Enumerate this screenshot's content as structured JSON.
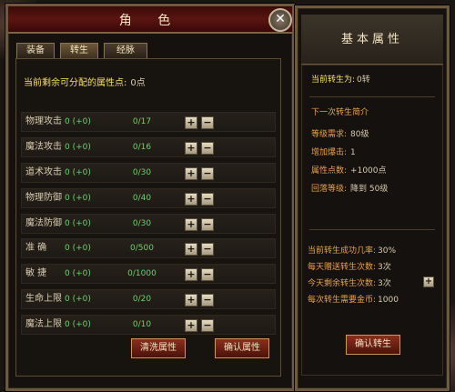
{
  "window": {
    "title": "角 色",
    "close_label": "✕"
  },
  "tabs": [
    {
      "label": "装备",
      "active": false
    },
    {
      "label": "转生",
      "active": true
    },
    {
      "label": "经脉",
      "active": false
    }
  ],
  "points": {
    "label": "当前剩余可分配的属性点:",
    "value": "0点"
  },
  "attributes": [
    {
      "name": "物理攻击",
      "bonus": "0 (+0)",
      "max": "0/17"
    },
    {
      "name": "魔法攻击",
      "bonus": "0 (+0)",
      "max": "0/16"
    },
    {
      "name": "道术攻击",
      "bonus": "0 (+0)",
      "max": "0/30"
    },
    {
      "name": "物理防御",
      "bonus": "0 (+0)",
      "max": "0/40"
    },
    {
      "name": "魔法防御",
      "bonus": "0 (+0)",
      "max": "0/30"
    },
    {
      "name": "准    确",
      "bonus": "0 (+0)",
      "max": "0/500"
    },
    {
      "name": "敏    捷",
      "bonus": "0 (+0)",
      "max": "0/1000"
    },
    {
      "name": "生命上限",
      "bonus": "0 (+0)",
      "max": "0/20"
    },
    {
      "name": "魔法上限",
      "bonus": "0 (+0)",
      "max": "0/10"
    }
  ],
  "buttons": {
    "reset": "清洗属性",
    "confirm_attr": "确认属性",
    "confirm_reborn": "确认转生"
  },
  "plus_glyph": "+",
  "minus_glyph": "−",
  "right": {
    "title": "基本属性",
    "current_reborn_label": "当前转生为:",
    "current_reborn_value": "0转",
    "next_title": "下一次转生简介",
    "next_items": [
      {
        "label": "等级需求:",
        "value": "80级"
      },
      {
        "label": "增加爆击:",
        "value": "1"
      },
      {
        "label": "属性点数:",
        "value": "+1000点"
      },
      {
        "label": "回落等级:",
        "value": "降到  50级"
      }
    ],
    "stats": [
      {
        "label": "当前转生成功几率:",
        "value": "30%"
      },
      {
        "label": "每天赠送转生次数:",
        "value": "3次"
      },
      {
        "label": "今天剩余转生次数:",
        "value": "3次"
      },
      {
        "label": "每次转生需要金币:",
        "value": "1000"
      }
    ]
  },
  "colors": {
    "yellow": "#f5e15c",
    "green": "#6ed06e",
    "orange": "#e8a24a",
    "frame": "#6d5a3c"
  }
}
